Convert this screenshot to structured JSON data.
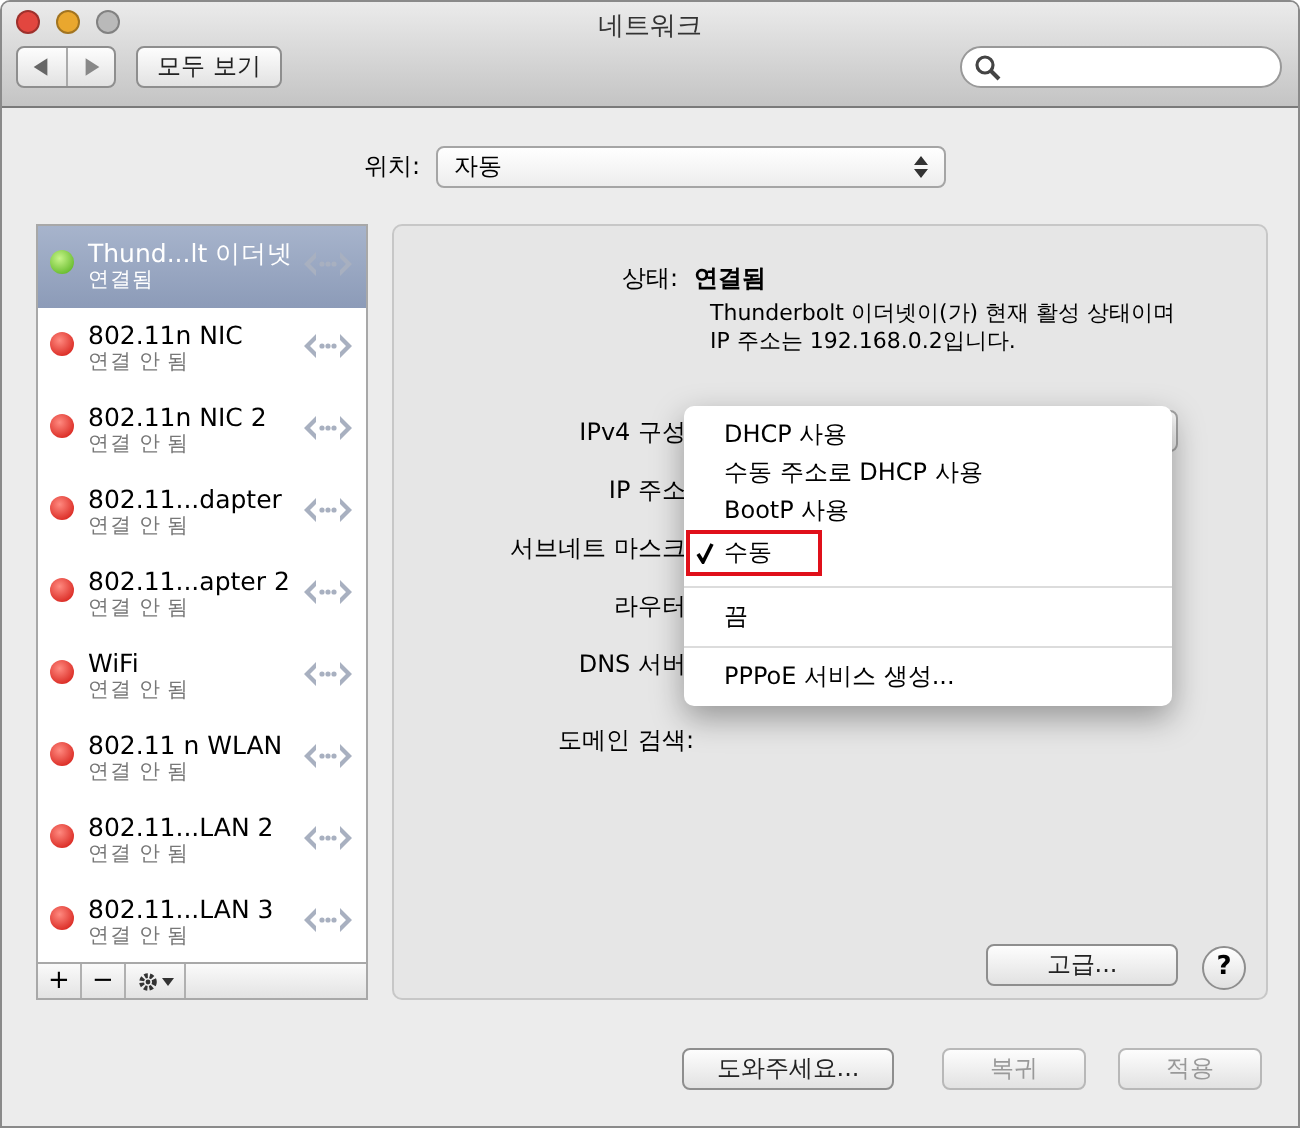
{
  "window": {
    "title": "네트워크"
  },
  "toolbar": {
    "show_all": "모두 보기"
  },
  "location": {
    "label": "위치:",
    "value": "자동"
  },
  "services": [
    {
      "name": "Thund...lt 이더넷",
      "status": "연결됨",
      "connected": true,
      "selected": true
    },
    {
      "name": "802.11n NIC",
      "status": "연결 안 됨",
      "connected": false,
      "selected": false
    },
    {
      "name": "802.11n NIC 2",
      "status": "연결 안 됨",
      "connected": false,
      "selected": false
    },
    {
      "name": "802.11...dapter",
      "status": "연결 안 됨",
      "connected": false,
      "selected": false
    },
    {
      "name": "802.11...apter 2",
      "status": "연결 안 됨",
      "connected": false,
      "selected": false
    },
    {
      "name": "WiFi",
      "status": "연결 안 됨",
      "connected": false,
      "selected": false
    },
    {
      "name": "802.11 n WLAN",
      "status": "연결 안 됨",
      "connected": false,
      "selected": false
    },
    {
      "name": "802.11...LAN 2",
      "status": "연결 안 됨",
      "connected": false,
      "selected": false
    },
    {
      "name": "802.11...LAN 3",
      "status": "연결 안 됨",
      "connected": false,
      "selected": false
    }
  ],
  "list_buttons": [
    "+",
    "−"
  ],
  "detail": {
    "status_label": "상태:",
    "status_value": "연결됨",
    "description": "Thunderbolt 이더넷이(가) 현재 활성 상태이며 IP 주소는 192.168.0.2입니다.",
    "fields": [
      {
        "label": "IPv4 구성"
      },
      {
        "label": "IP 주소"
      },
      {
        "label": "서브네트 마스크"
      },
      {
        "label": "라우터"
      },
      {
        "label": "DNS 서버"
      },
      {
        "label": "도메인 검색:"
      }
    ],
    "advanced": "고급...",
    "help": "?"
  },
  "menu": {
    "items": [
      {
        "kind": "item",
        "label": "DHCP 사용",
        "checked": false,
        "highlighted": false
      },
      {
        "kind": "item",
        "label": "수동 주소로 DHCP 사용",
        "checked": false,
        "highlighted": false
      },
      {
        "kind": "item",
        "label": "BootP 사용",
        "checked": false,
        "highlighted": false
      },
      {
        "kind": "item",
        "label": "수동",
        "checked": true,
        "highlighted": true
      },
      {
        "kind": "separator"
      },
      {
        "kind": "item",
        "label": "끔",
        "checked": false,
        "highlighted": false
      },
      {
        "kind": "separator"
      },
      {
        "kind": "item",
        "label": "PPPoE 서비스 생성...",
        "checked": false,
        "highlighted": false
      }
    ]
  },
  "buttons": [
    {
      "label": "도와주세요...",
      "disabled": false
    },
    {
      "label": "복귀",
      "disabled": true
    },
    {
      "label": "적용",
      "disabled": true
    }
  ]
}
